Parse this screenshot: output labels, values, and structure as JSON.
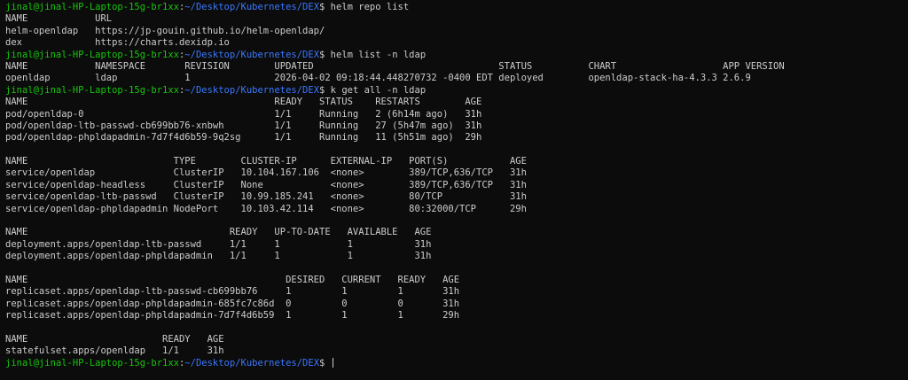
{
  "colors": {
    "background": "#0c0c0c",
    "text": "#cccccc",
    "user_host": "#16c60c",
    "path": "#3b78ff"
  },
  "prompt": {
    "user_host": "jinal@jinal-HP-Laptop-15g-br1xx",
    "separator": ":",
    "path": "~/Desktop/Kubernetes/DEX",
    "symbol": "$ "
  },
  "lines": [
    {
      "type": "prompt",
      "command": "helm repo list"
    },
    {
      "type": "output",
      "text": "NAME            URL"
    },
    {
      "type": "output",
      "text": "helm-openldap   https://jp-gouin.github.io/helm-openldap/"
    },
    {
      "type": "output",
      "text": "dex             https://charts.dexidp.io"
    },
    {
      "type": "prompt",
      "command": "helm list -n ldap"
    },
    {
      "type": "output",
      "text": "NAME            NAMESPACE       REVISION        UPDATED                                 STATUS          CHART                   APP VERSION"
    },
    {
      "type": "output",
      "text": "openldap        ldap            1               2026-04-02 09:18:44.448270732 -0400 EDT deployed        openldap-stack-ha-4.3.3 2.6.9"
    },
    {
      "type": "prompt",
      "command": "k get all -n ldap"
    },
    {
      "type": "output",
      "text": "NAME                                            READY   STATUS    RESTARTS        AGE"
    },
    {
      "type": "output",
      "text": "pod/openldap-0                                  1/1     Running   2 (6h14m ago)   31h"
    },
    {
      "type": "output",
      "text": "pod/openldap-ltb-passwd-cb699bb76-xnbwh         1/1     Running   27 (5h47m ago)  31h"
    },
    {
      "type": "output",
      "text": "pod/openldap-phpldapadmin-7d7f4d6b59-9q2sg      1/1     Running   11 (5h51m ago)  29h"
    },
    {
      "type": "output",
      "text": ""
    },
    {
      "type": "output",
      "text": "NAME                          TYPE        CLUSTER-IP      EXTERNAL-IP   PORT(S)           AGE"
    },
    {
      "type": "output",
      "text": "service/openldap              ClusterIP   10.104.167.106  <none>        389/TCP,636/TCP   31h"
    },
    {
      "type": "output",
      "text": "service/openldap-headless     ClusterIP   None            <none>        389/TCP,636/TCP   31h"
    },
    {
      "type": "output",
      "text": "service/openldap-ltb-passwd   ClusterIP   10.99.185.241   <none>        80/TCP            31h"
    },
    {
      "type": "output",
      "text": "service/openldap-phpldapadmin NodePort    10.103.42.114   <none>        80:32000/TCP      29h"
    },
    {
      "type": "output",
      "text": ""
    },
    {
      "type": "output",
      "text": "NAME                                    READY   UP-TO-DATE   AVAILABLE   AGE"
    },
    {
      "type": "output",
      "text": "deployment.apps/openldap-ltb-passwd     1/1     1            1           31h"
    },
    {
      "type": "output",
      "text": "deployment.apps/openldap-phpldapadmin   1/1     1            1           31h"
    },
    {
      "type": "output",
      "text": ""
    },
    {
      "type": "output",
      "text": "NAME                                              DESIRED   CURRENT   READY   AGE"
    },
    {
      "type": "output",
      "text": "replicaset.apps/openldap-ltb-passwd-cb699bb76     1         1         1       31h"
    },
    {
      "type": "output",
      "text": "replicaset.apps/openldap-phpldapadmin-685fc7c86d  0         0         0       31h"
    },
    {
      "type": "output",
      "text": "replicaset.apps/openldap-phpldapadmin-7d7f4d6b59  1         1         1       29h"
    },
    {
      "type": "output",
      "text": ""
    },
    {
      "type": "output",
      "text": "NAME                        READY   AGE"
    },
    {
      "type": "output",
      "text": "statefulset.apps/openldap   1/1     31h"
    },
    {
      "type": "prompt",
      "command": "",
      "cursor": true
    }
  ]
}
